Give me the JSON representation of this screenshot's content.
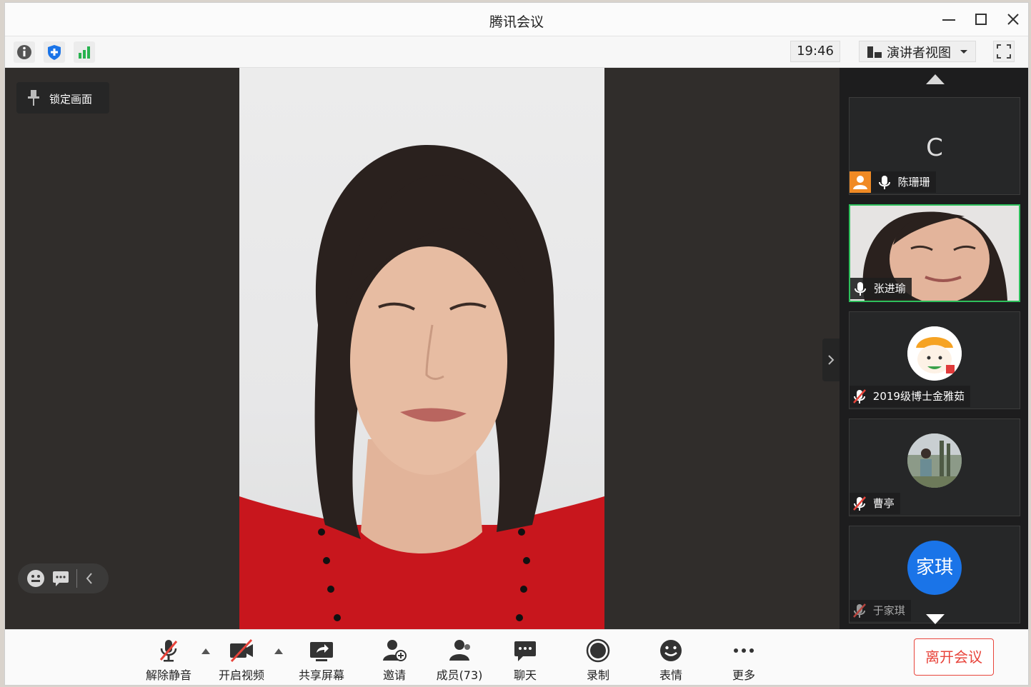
{
  "window": {
    "title": "腾讯会议"
  },
  "toolbar": {
    "time": "19:46",
    "view_label": "演讲者视图"
  },
  "stage": {
    "lock_label": "锁定画面"
  },
  "participants": [
    {
      "name": "陈珊珊",
      "avatar_letter": "C"
    },
    {
      "name": "张进瑜"
    },
    {
      "name": "2019级博士金雅茹"
    },
    {
      "name": "曹亭"
    },
    {
      "name": "于家琪",
      "avatar_text": "家琪"
    }
  ],
  "bottom": {
    "unmute": "解除静音",
    "start_video": "开启视频",
    "share_screen": "共享屏幕",
    "invite": "邀请",
    "members": "成员(73)",
    "chat": "聊天",
    "record": "录制",
    "reactions": "表情",
    "more": "更多",
    "leave": "离开会议"
  },
  "colors": {
    "accent_red": "#e8443b",
    "active_border": "#2ec05c",
    "avatar_blue": "#1a74e8"
  }
}
